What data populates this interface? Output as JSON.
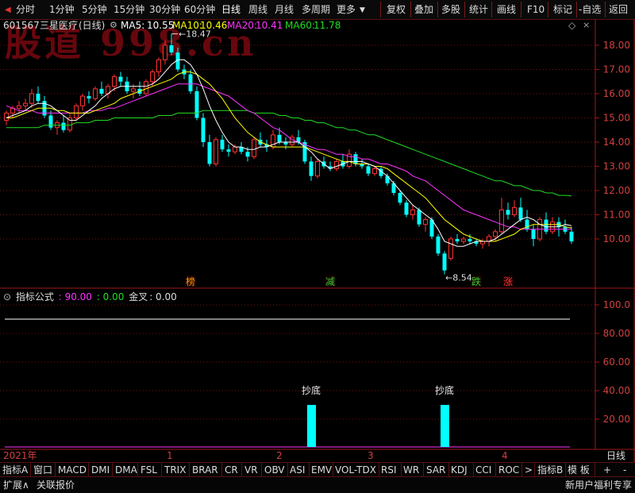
{
  "toolbar": {
    "periods": [
      "分时",
      "1分钟",
      "5分钟",
      "15分钟",
      "30分钟",
      "60分钟",
      "日线",
      "周线",
      "月线",
      "多周期",
      "更多"
    ],
    "more_arrow": "▼",
    "actions": [
      "复权",
      "叠加",
      "多股",
      "统计",
      "画线",
      "F10",
      "标记",
      "-自选",
      "返回"
    ],
    "window_controls": [
      "-",
      "□",
      "×"
    ]
  },
  "stock": {
    "code": "601567",
    "name": "三星医疗",
    "period_label": "(日线)"
  },
  "ma": {
    "ma5": {
      "label": "MA5:",
      "value": "10.55",
      "color": "#ffffff"
    },
    "ma10": {
      "label": "MA10:",
      "value": "10.46",
      "color": "#ffff00"
    },
    "ma20": {
      "label": "MA20:",
      "value": "10.41",
      "color": "#ff33ff"
    },
    "ma60": {
      "label": "MA60:",
      "value": "11.78",
      "color": "#22dd22"
    }
  },
  "watermark_text": "股道 998.cn",
  "price_axis": [
    "18.00",
    "17.00",
    "16.00",
    "15.00",
    "14.00",
    "13.00",
    "12.00",
    "11.00",
    "10.00"
  ],
  "annotations": {
    "high_label": "18.47",
    "low_label": "8.54",
    "badges": [
      {
        "text": "榜",
        "color": "#ff9900"
      },
      {
        "text": "减",
        "color": "#33cc33"
      },
      {
        "text": "跌",
        "color": "#33cc33"
      },
      {
        "text": "涨",
        "color": "#ff3333"
      }
    ]
  },
  "indicator": {
    "name": "指标公式",
    "v1": ": 90.00",
    "v2": ": 0.00",
    "v3_label": "金叉",
    "v3": ": 0.00",
    "v1_color": "#ff33ff",
    "v2_color": "#22dd22",
    "axis": [
      "100.0",
      "80.00",
      "60.00",
      "40.00",
      "20.00"
    ],
    "bar_labels": [
      "抄底",
      "抄底"
    ]
  },
  "date_axis": [
    "2021年",
    "1",
    "2",
    "3",
    "4"
  ],
  "right_panel_label": "日线",
  "tabs": [
    "指标A",
    "窗口",
    "MACD",
    "DMI",
    "DMA",
    "FSL",
    "TRIX",
    "BRAR",
    "CR",
    "VR",
    "OBV",
    "ASI",
    "EMV",
    "VOL-TDX",
    "RSI",
    "WR",
    "SAR",
    "KDJ",
    "CCI",
    "ROC",
    ">",
    "指标B",
    "模 板",
    "+",
    "-"
  ],
  "status": {
    "left1": "扩展∧",
    "left2": "关联报价",
    "right": "新用户福利专享"
  },
  "colors": {
    "up": "#ff3333",
    "down": "#00ffff",
    "ma5": "#ffffff",
    "ma10": "#ffff00",
    "ma20": "#ff33ff",
    "ma60": "#22dd22",
    "grid": "#7a1010"
  },
  "chart_data": {
    "type": "candlestick",
    "ylim": [
      8.3,
      18.8
    ],
    "candles": [
      [
        14.9,
        15.3,
        14.7,
        15.2
      ],
      [
        15.2,
        15.5,
        15.0,
        15.4
      ],
      [
        15.4,
        15.7,
        15.2,
        15.5
      ],
      [
        15.5,
        15.8,
        15.3,
        15.6
      ],
      [
        15.6,
        16.2,
        15.4,
        16.0
      ],
      [
        16.0,
        16.3,
        15.6,
        15.7
      ],
      [
        15.7,
        15.9,
        15.0,
        15.1
      ],
      [
        15.1,
        15.3,
        14.5,
        14.6
      ],
      [
        14.6,
        14.9,
        14.3,
        14.8
      ],
      [
        14.8,
        15.1,
        14.4,
        14.5
      ],
      [
        14.5,
        15.2,
        14.4,
        15.0
      ],
      [
        15.0,
        15.6,
        14.9,
        15.5
      ],
      [
        15.5,
        16.0,
        15.3,
        15.9
      ],
      [
        15.9,
        16.1,
        15.6,
        15.8
      ],
      [
        15.8,
        16.3,
        15.7,
        16.2
      ],
      [
        16.2,
        16.5,
        15.9,
        16.0
      ],
      [
        16.0,
        16.4,
        15.8,
        16.3
      ],
      [
        16.3,
        16.8,
        16.1,
        16.7
      ],
      [
        16.7,
        16.9,
        16.3,
        16.5
      ],
      [
        16.5,
        16.7,
        16.0,
        16.1
      ],
      [
        16.1,
        16.4,
        15.8,
        16.2
      ],
      [
        16.2,
        16.5,
        15.9,
        16.0
      ],
      [
        16.0,
        16.6,
        15.9,
        16.5
      ],
      [
        16.5,
        17.0,
        16.3,
        16.9
      ],
      [
        16.9,
        17.5,
        16.7,
        17.4
      ],
      [
        17.4,
        18.2,
        17.2,
        18.0
      ],
      [
        18.0,
        18.47,
        17.6,
        17.7
      ],
      [
        17.7,
        17.9,
        16.9,
        17.0
      ],
      [
        17.0,
        17.2,
        16.6,
        16.8
      ],
      [
        16.8,
        17.0,
        16.0,
        16.1
      ],
      [
        16.1,
        16.3,
        14.9,
        15.0
      ],
      [
        15.0,
        15.2,
        13.8,
        14.0
      ],
      [
        14.0,
        14.3,
        13.0,
        13.1
      ],
      [
        13.1,
        14.2,
        13.0,
        14.1
      ],
      [
        14.1,
        14.3,
        13.6,
        13.7
      ],
      [
        13.7,
        13.9,
        13.4,
        13.6
      ],
      [
        13.6,
        13.9,
        13.5,
        13.8
      ],
      [
        13.8,
        14.0,
        13.5,
        13.6
      ],
      [
        13.6,
        13.8,
        13.2,
        13.4
      ],
      [
        13.4,
        14.2,
        13.3,
        14.1
      ],
      [
        14.1,
        14.4,
        13.8,
        13.9
      ],
      [
        13.9,
        14.1,
        13.6,
        13.8
      ],
      [
        13.8,
        14.5,
        13.7,
        14.3
      ],
      [
        14.3,
        14.6,
        13.9,
        14.0
      ],
      [
        14.0,
        14.2,
        13.7,
        13.9
      ],
      [
        13.9,
        14.3,
        13.8,
        14.2
      ],
      [
        14.2,
        14.5,
        13.9,
        14.0
      ],
      [
        14.0,
        14.1,
        13.1,
        13.2
      ],
      [
        13.2,
        13.4,
        12.4,
        12.6
      ],
      [
        12.6,
        13.3,
        12.5,
        13.2
      ],
      [
        13.2,
        13.4,
        12.9,
        13.0
      ],
      [
        13.0,
        13.2,
        12.8,
        12.9
      ],
      [
        12.9,
        13.3,
        12.8,
        13.2
      ],
      [
        13.2,
        13.5,
        12.9,
        13.0
      ],
      [
        13.0,
        13.7,
        12.9,
        13.5
      ],
      [
        13.5,
        13.6,
        13.0,
        13.1
      ],
      [
        13.1,
        13.3,
        12.9,
        13.0
      ],
      [
        13.0,
        13.1,
        12.6,
        12.7
      ],
      [
        12.7,
        13.0,
        12.6,
        12.9
      ],
      [
        12.9,
        13.0,
        12.5,
        12.6
      ],
      [
        12.6,
        12.7,
        12.2,
        12.3
      ],
      [
        12.3,
        12.4,
        11.8,
        11.9
      ],
      [
        11.9,
        12.0,
        11.4,
        11.5
      ],
      [
        11.5,
        11.6,
        10.9,
        11.0
      ],
      [
        11.0,
        11.4,
        10.8,
        11.2
      ],
      [
        11.2,
        11.3,
        10.5,
        10.6
      ],
      [
        10.6,
        10.9,
        10.3,
        10.8
      ],
      [
        10.8,
        10.9,
        10.0,
        10.1
      ],
      [
        10.1,
        10.2,
        9.3,
        9.4
      ],
      [
        9.4,
        9.5,
        8.54,
        8.7
      ],
      [
        9.2,
        10.1,
        9.1,
        10.0
      ],
      [
        10.0,
        10.2,
        9.8,
        9.9
      ],
      [
        9.9,
        10.1,
        9.8,
        10.0
      ],
      [
        10.0,
        10.2,
        9.8,
        9.9
      ],
      [
        9.9,
        10.0,
        9.7,
        9.8
      ],
      [
        9.8,
        10.0,
        9.6,
        9.9
      ],
      [
        9.9,
        10.2,
        9.7,
        10.1
      ],
      [
        10.1,
        10.4,
        9.9,
        10.3
      ],
      [
        10.3,
        11.7,
        10.2,
        11.2
      ],
      [
        11.2,
        11.5,
        10.8,
        11.0
      ],
      [
        11.0,
        11.6,
        10.9,
        11.3
      ],
      [
        11.3,
        11.7,
        10.7,
        10.8
      ],
      [
        10.8,
        11.2,
        10.3,
        10.4
      ],
      [
        10.4,
        10.6,
        9.7,
        10.0
      ],
      [
        10.0,
        10.9,
        9.9,
        10.8
      ],
      [
        10.8,
        11.1,
        10.2,
        10.3
      ],
      [
        10.3,
        10.9,
        10.2,
        10.7
      ],
      [
        10.7,
        10.9,
        10.1,
        10.5
      ],
      [
        10.5,
        10.8,
        10.2,
        10.3
      ],
      [
        10.3,
        10.5,
        9.8,
        9.9
      ]
    ],
    "ma5": [
      15.0,
      15.1,
      15.2,
      15.3,
      15.5,
      15.6,
      15.6,
      15.5,
      15.3,
      15.1,
      14.9,
      14.9,
      15.1,
      15.3,
      15.5,
      15.8,
      16.0,
      16.2,
      16.3,
      16.3,
      16.3,
      16.3,
      16.3,
      16.4,
      16.6,
      16.9,
      17.2,
      17.4,
      17.4,
      17.2,
      16.8,
      16.2,
      15.5,
      14.9,
      14.4,
      14.0,
      13.8,
      13.8,
      13.7,
      13.7,
      13.8,
      13.8,
      13.9,
      14.0,
      14.0,
      14.0,
      14.0,
      13.8,
      13.6,
      13.3,
      13.1,
      12.9,
      13.0,
      13.1,
      13.2,
      13.2,
      13.2,
      13.1,
      13.0,
      12.8,
      12.6,
      12.3,
      12.0,
      11.7,
      11.4,
      11.2,
      11.0,
      10.8,
      10.4,
      9.9,
      9.8,
      9.7,
      9.7,
      9.8,
      9.9,
      9.9,
      9.9,
      10.0,
      10.2,
      10.4,
      10.6,
      10.8,
      10.9,
      10.8,
      10.6,
      10.5,
      10.5,
      10.5,
      10.6,
      10.55
    ],
    "ma10": [
      15.0,
      15.0,
      15.1,
      15.2,
      15.3,
      15.4,
      15.4,
      15.4,
      15.3,
      15.3,
      15.2,
      15.2,
      15.2,
      15.2,
      15.3,
      15.4,
      15.5,
      15.6,
      15.8,
      15.9,
      16.0,
      16.1,
      16.2,
      16.3,
      16.4,
      16.5,
      16.6,
      16.8,
      16.9,
      16.9,
      16.8,
      16.6,
      16.4,
      16.1,
      15.8,
      15.4,
      15.0,
      14.7,
      14.4,
      14.2,
      14.0,
      13.9,
      13.8,
      13.8,
      13.8,
      13.8,
      13.8,
      13.8,
      13.7,
      13.6,
      13.5,
      13.4,
      13.3,
      13.2,
      13.2,
      13.1,
      13.1,
      13.1,
      13.0,
      13.0,
      12.9,
      12.7,
      12.5,
      12.3,
      12.1,
      11.9,
      11.7,
      11.4,
      11.1,
      10.8,
      10.6,
      10.4,
      10.2,
      10.1,
      10.0,
      9.9,
      9.9,
      9.9,
      10.0,
      10.1,
      10.2,
      10.4,
      10.5,
      10.6,
      10.6,
      10.6,
      10.6,
      10.6,
      10.5,
      10.46
    ],
    "ma20": [
      15.5,
      15.4,
      15.3,
      15.3,
      15.3,
      15.2,
      15.2,
      15.2,
      15.2,
      15.2,
      15.2,
      15.2,
      15.2,
      15.3,
      15.3,
      15.3,
      15.4,
      15.4,
      15.5,
      15.6,
      15.7,
      15.8,
      15.9,
      16.0,
      16.1,
      16.2,
      16.3,
      16.4,
      16.4,
      16.4,
      16.4,
      16.3,
      16.2,
      16.1,
      16.0,
      15.9,
      15.7,
      15.5,
      15.3,
      15.2,
      15.0,
      14.8,
      14.6,
      14.5,
      14.3,
      14.1,
      14.0,
      13.9,
      13.8,
      13.7,
      13.7,
      13.6,
      13.5,
      13.5,
      13.4,
      13.4,
      13.3,
      13.3,
      13.2,
      13.1,
      13.1,
      13.0,
      12.9,
      12.8,
      12.6,
      12.5,
      12.4,
      12.2,
      12.0,
      11.8,
      11.6,
      11.4,
      11.2,
      11.1,
      11.0,
      10.9,
      10.8,
      10.7,
      10.6,
      10.5,
      10.5,
      10.4,
      10.4,
      10.4,
      10.4,
      10.4,
      10.4,
      10.4,
      10.4,
      10.41
    ],
    "ma60": [
      14.6,
      14.6,
      14.6,
      14.6,
      14.6,
      14.6,
      14.7,
      14.7,
      14.7,
      14.7,
      14.7,
      14.8,
      14.8,
      14.8,
      14.9,
      14.9,
      14.9,
      15.0,
      15.0,
      15.0,
      15.0,
      15.0,
      15.0,
      15.0,
      15.1,
      15.1,
      15.1,
      15.2,
      15.2,
      15.2,
      15.2,
      15.3,
      15.3,
      15.3,
      15.3,
      15.3,
      15.3,
      15.3,
      15.3,
      15.2,
      15.2,
      15.2,
      15.2,
      15.1,
      15.1,
      15.0,
      15.0,
      14.9,
      14.9,
      14.8,
      14.8,
      14.7,
      14.6,
      14.6,
      14.5,
      14.5,
      14.4,
      14.3,
      14.3,
      14.2,
      14.1,
      14.0,
      13.9,
      13.8,
      13.7,
      13.6,
      13.5,
      13.4,
      13.3,
      13.2,
      13.1,
      13.0,
      12.9,
      12.8,
      12.7,
      12.6,
      12.5,
      12.4,
      12.4,
      12.3,
      12.2,
      12.2,
      12.1,
      12.0,
      12.0,
      11.9,
      11.9,
      11.8,
      11.8,
      11.78
    ],
    "indicator_line": 90,
    "indicator_bars": [
      {
        "index": 48,
        "value": 30
      },
      {
        "index": 69,
        "value": 30
      }
    ],
    "indicator_ylim": [
      0,
      110
    ]
  }
}
